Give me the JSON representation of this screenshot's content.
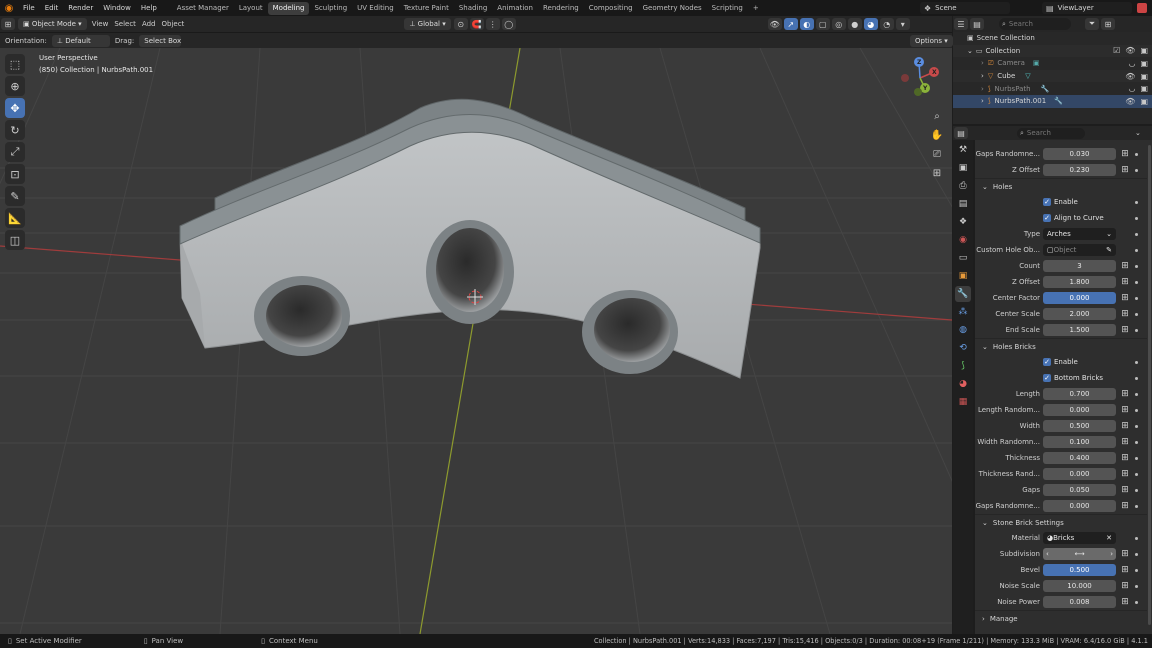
{
  "menu": {
    "items": [
      "File",
      "Edit",
      "Render",
      "Window",
      "Help"
    ],
    "workspaces": [
      "Asset Manager",
      "Layout",
      "Modeling",
      "Sculpting",
      "UV Editing",
      "Texture Paint",
      "Shading",
      "Animation",
      "Rendering",
      "Compositing",
      "Geometry Nodes",
      "Scripting"
    ],
    "active_workspace_index": 2,
    "add_tab": "+",
    "scene": "Scene",
    "view_layer": "ViewLayer"
  },
  "viewport_header": {
    "mode": "Object Mode",
    "menus": [
      "View",
      "Select",
      "Add",
      "Object"
    ],
    "transform_orientation": "Global",
    "options": "Options"
  },
  "tool_settings": {
    "orientation_label": "Orientation:",
    "orientation_value": "Default",
    "drag_label": "Drag:",
    "drag_value": "Select Box"
  },
  "viewport": {
    "perspective": "User Perspective",
    "collection_info": "(850) Collection | NurbsPath.001",
    "gizmo_axes": [
      "X",
      "Y",
      "Z"
    ]
  },
  "outliner": {
    "search_placeholder": "Search",
    "rows": [
      {
        "label": "Scene Collection",
        "dim": false
      },
      {
        "label": "Collection",
        "dim": false
      },
      {
        "label": "Camera",
        "dim": true
      },
      {
        "label": "Cube",
        "dim": false
      },
      {
        "label": "NurbsPath",
        "dim": true
      },
      {
        "label": "NurbsPath.001",
        "dim": false
      }
    ]
  },
  "properties": {
    "search_placeholder": "Search",
    "rows": [
      {
        "kind": "field",
        "label": "Gaps Randomne...",
        "value": "0.030"
      },
      {
        "kind": "field",
        "label": "Z Offset",
        "value": "0.230"
      },
      {
        "kind": "section",
        "label": "Holes"
      },
      {
        "kind": "check",
        "label": "Enable"
      },
      {
        "kind": "check",
        "label": "Align to Curve"
      },
      {
        "kind": "enum",
        "label": "Type",
        "value": "Arches"
      },
      {
        "kind": "object",
        "label": "Custom Hole Ob...",
        "value": "Object"
      },
      {
        "kind": "field",
        "label": "Count",
        "value": "3"
      },
      {
        "kind": "field",
        "label": "Z Offset",
        "value": "1.800"
      },
      {
        "kind": "blue",
        "label": "Center Factor",
        "value": "0.000"
      },
      {
        "kind": "field",
        "label": "Center Scale",
        "value": "2.000"
      },
      {
        "kind": "field",
        "label": "End Scale",
        "value": "1.500"
      },
      {
        "kind": "section",
        "label": "Holes Bricks"
      },
      {
        "kind": "check",
        "label": "Enable"
      },
      {
        "kind": "check",
        "label": "Bottom Bricks"
      },
      {
        "kind": "field",
        "label": "Length",
        "value": "0.700"
      },
      {
        "kind": "field",
        "label": "Length Random...",
        "value": "0.000"
      },
      {
        "kind": "field",
        "label": "Width",
        "value": "0.500"
      },
      {
        "kind": "field",
        "label": "Width Randomn...",
        "value": "0.100"
      },
      {
        "kind": "field",
        "label": "Thickness",
        "value": "0.400"
      },
      {
        "kind": "field",
        "label": "Thickness Rand...",
        "value": "0.000"
      },
      {
        "kind": "field",
        "label": "Gaps",
        "value": "0.050"
      },
      {
        "kind": "field",
        "label": "Gaps Randomne...",
        "value": "0.000"
      },
      {
        "kind": "section",
        "label": "Stone Brick Settings"
      },
      {
        "kind": "material",
        "label": "Material",
        "value": "Bricks"
      },
      {
        "kind": "slider",
        "label": "Subdivision",
        "value": ""
      },
      {
        "kind": "blue",
        "label": "Bevel",
        "value": "0.500"
      },
      {
        "kind": "field",
        "label": "Noise Scale",
        "value": "10.000"
      },
      {
        "kind": "field",
        "label": "Noise Power",
        "value": "0.008"
      },
      {
        "kind": "section",
        "label": "Manage"
      }
    ]
  },
  "statusbar": {
    "left": "Set Active Modifier",
    "middle": "Pan View",
    "context": "Context Menu",
    "stats": "Collection | NurbsPath.001 | Verts:14,833 | Faces:7,197 | Tris:15,416 | Objects:0/3 | Duration: 00:08+19 (Frame 1/211) | Memory: 133.3 MiB | VRAM: 6.4/16.0 GiB | 4.1.1"
  },
  "colors": {
    "accent": "#4772b3",
    "viewport_bg": "#3a3a3a",
    "axis_x": "#c74a4a",
    "axis_y": "#9fb33a",
    "stone": "#b9bcbe"
  }
}
